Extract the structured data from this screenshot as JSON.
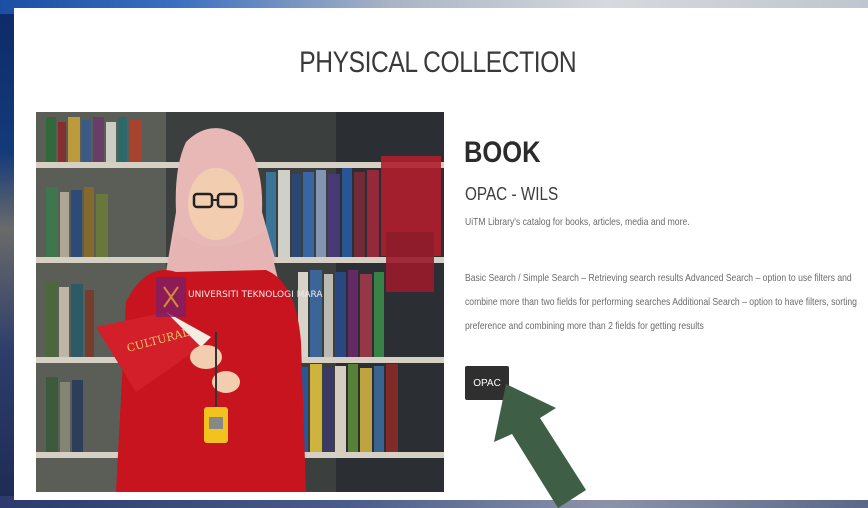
{
  "section": {
    "title": "PHYSICAL COLLECTION"
  },
  "card": {
    "heading": "BOOK",
    "subheading": "OPAC - WILS",
    "description": "UiTM Library's catalog for books, articles, media and more.",
    "details": "Basic Search / Simple Search – Retrieving search results Advanced Search – option to use filters and combine more than two fields for performing searches Additional Search – option to have filters, sorting preference and combining more than 2 fields for getting results",
    "button_label": "OPAC"
  },
  "photo": {
    "logo_text": "UNIVERSITI TEKNOLOGI MARA"
  },
  "colors": {
    "button_bg": "#2f2f2f",
    "arrow": "#3e5e45",
    "title_text": "#3a3a3a"
  }
}
